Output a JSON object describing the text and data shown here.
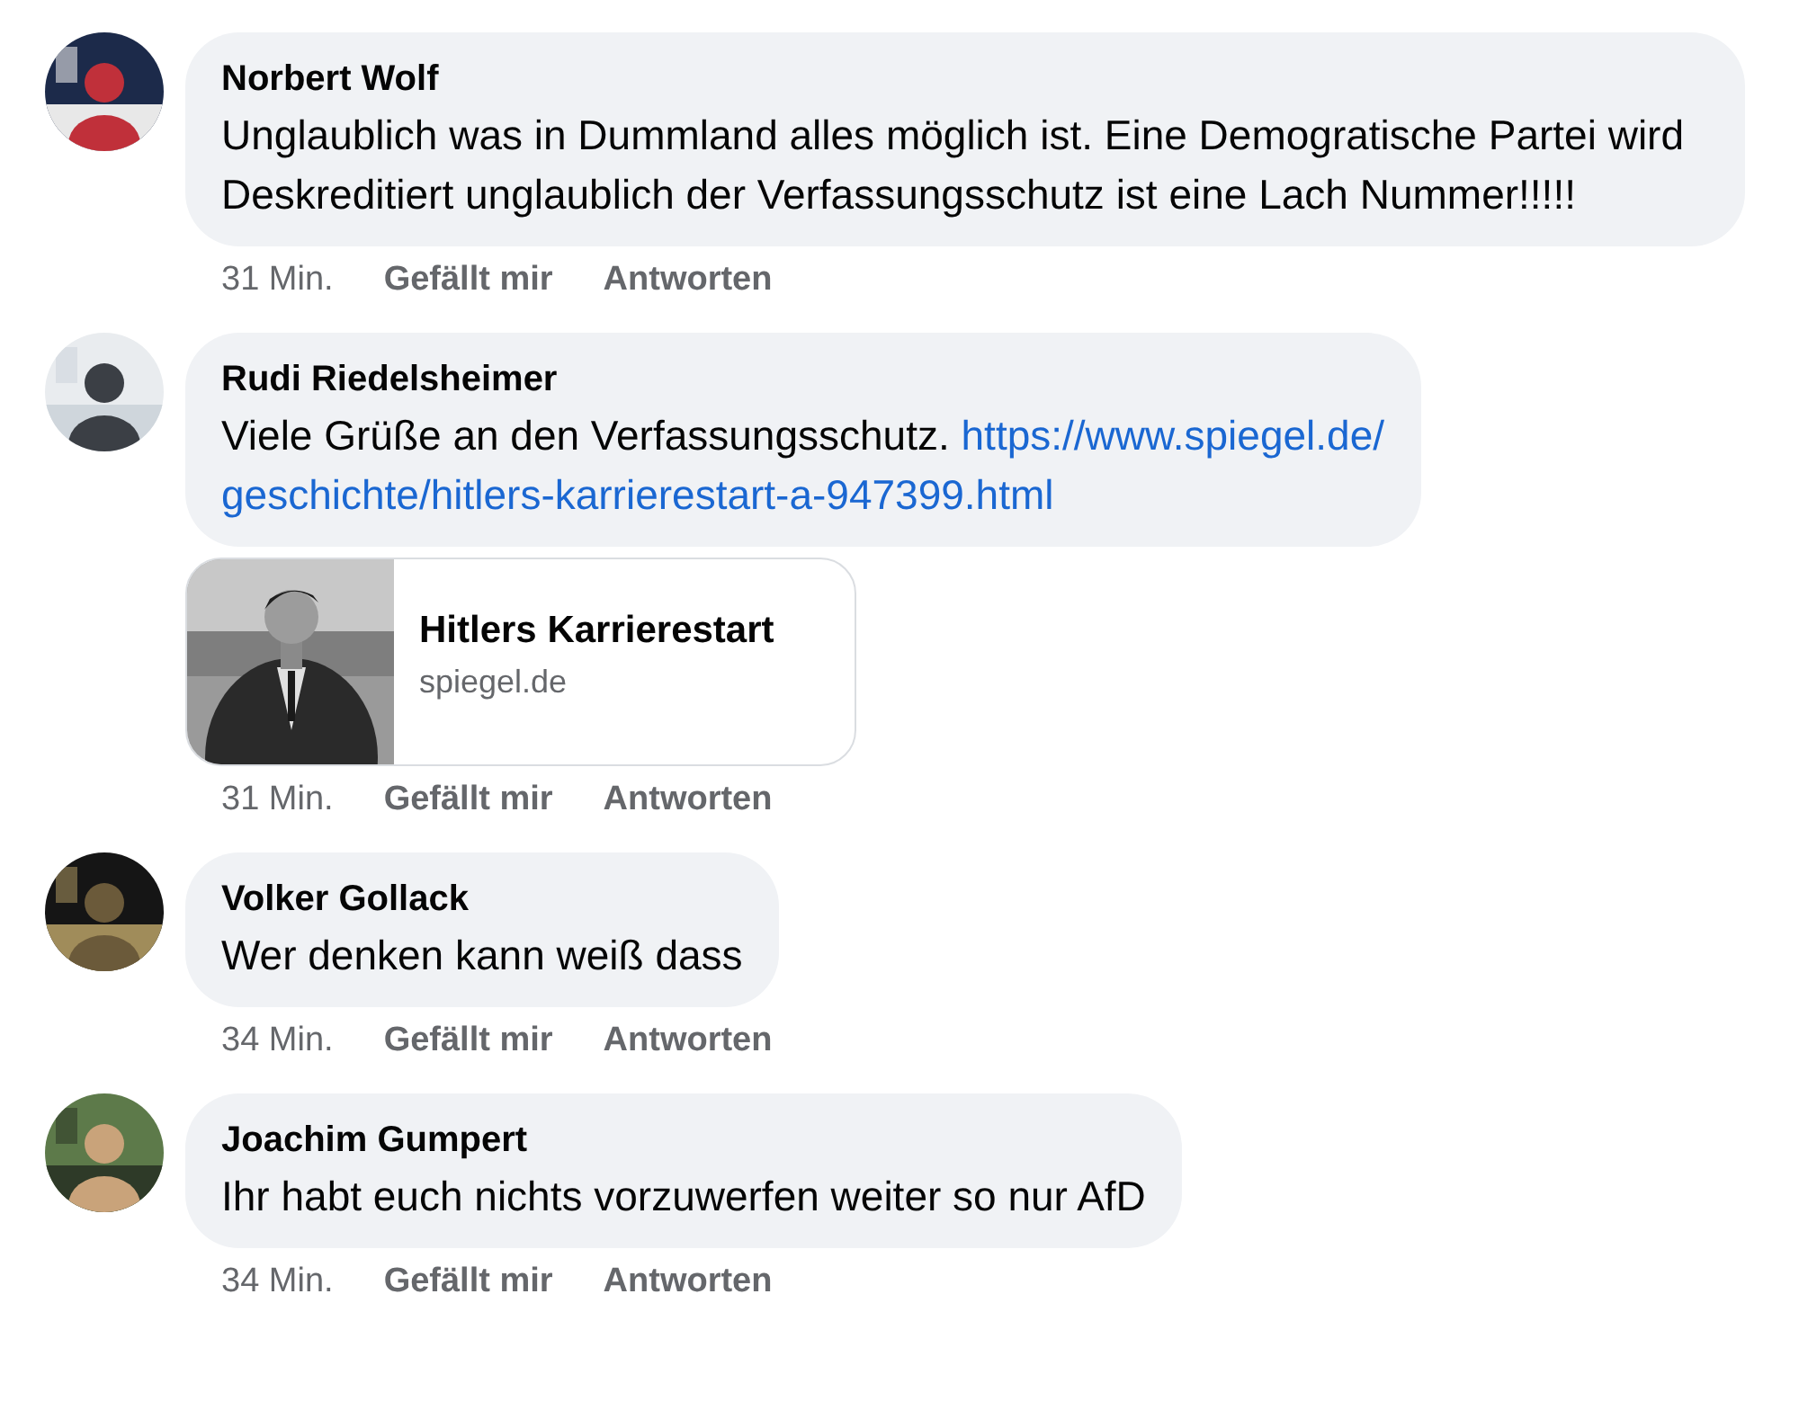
{
  "comments": [
    {
      "author": "Norbert Wolf",
      "text": "Unglaublich was in Dummland alles möglich ist. Eine Demogratische Partei wird Deskreditiert unglaublich der Verfassungsschutz ist eine Lach Nummer!!!!!",
      "time": "31 Min.",
      "like": "Gefällt mir",
      "reply": "Antworten"
    },
    {
      "author": "Rudi Riedelsheimer",
      "text": "Viele Grüße an den Verfassungsschutz.",
      "link": [
        "https://www.spiegel.de/",
        "geschichte/hitlers-karrierestart-a-947399.html"
      ],
      "preview": {
        "title": "Hitlers Karrierestart",
        "domain": "spiegel.de"
      },
      "time": "31 Min.",
      "like": "Gefällt mir",
      "reply": "Antworten"
    },
    {
      "author": "Volker Gollack",
      "text": "Wer denken kann weiß dass",
      "time": "34 Min.",
      "like": "Gefällt mir",
      "reply": "Antworten"
    },
    {
      "author": "Joachim Gumpert",
      "text": "Ihr habt euch nichts vorzuwerfen weiter so nur AfD",
      "time": "34 Min.",
      "like": "Gefällt mir",
      "reply": "Antworten"
    }
  ]
}
